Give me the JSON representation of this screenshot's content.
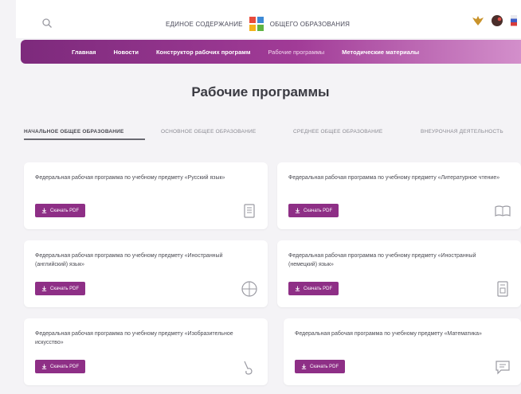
{
  "header": {
    "brand_left": "Единое содержание",
    "brand_right": "общего образования",
    "brand_colors": [
      "#e84b3c",
      "#3d8ad6",
      "#f3b21b",
      "#5fb443"
    ],
    "icons": [
      "search-icon",
      "emblem-icon",
      "avatar-icon",
      "flag-icon"
    ]
  },
  "nav": {
    "items": [
      "Главная",
      "Новости",
      "Конструктор рабочих программ",
      "Рабочие программы",
      "Методические материалы"
    ]
  },
  "title": "Рабочие программы",
  "tabs": [
    "Начальное общее образование",
    "Основное общее образование",
    "Среднее общее образование",
    "Внеурочная деятельность"
  ],
  "cards": [
    {
      "text": "Федеральная рабочая программа по учебному предмету «Русский язык»",
      "button": "Скачать PDF",
      "icon": "book-icon"
    },
    {
      "text": "Федеральная рабочая программа по учебному предмету «Литературное чтение»",
      "button": "Скачать PDF",
      "icon": "open-book-icon"
    },
    {
      "text": "Федеральная рабочая программа по учебному предмету «Иностранный (английский) язык»",
      "button": "Скачать PDF",
      "icon": "globe-icon"
    },
    {
      "text": "Федеральная рабочая программа по учебному предмету «Иностранный (немецкий) язык»",
      "button": "Скачать PDF",
      "icon": "document-icon"
    },
    {
      "text": "Федеральная рабочая программа по учебному предмету «Изобразительное искусство»",
      "button": "Скачать PDF",
      "icon": "brush-icon"
    },
    {
      "text": "Федеральная рабочая программа по учебному предмету «Математика»",
      "button": "Скачать PDF",
      "icon": "chat-icon"
    }
  ],
  "colors": {
    "accent": "#8e2f86",
    "nav_start": "#7d2a7c",
    "nav_end": "#d38fcb",
    "background": "#f4f3f6"
  }
}
